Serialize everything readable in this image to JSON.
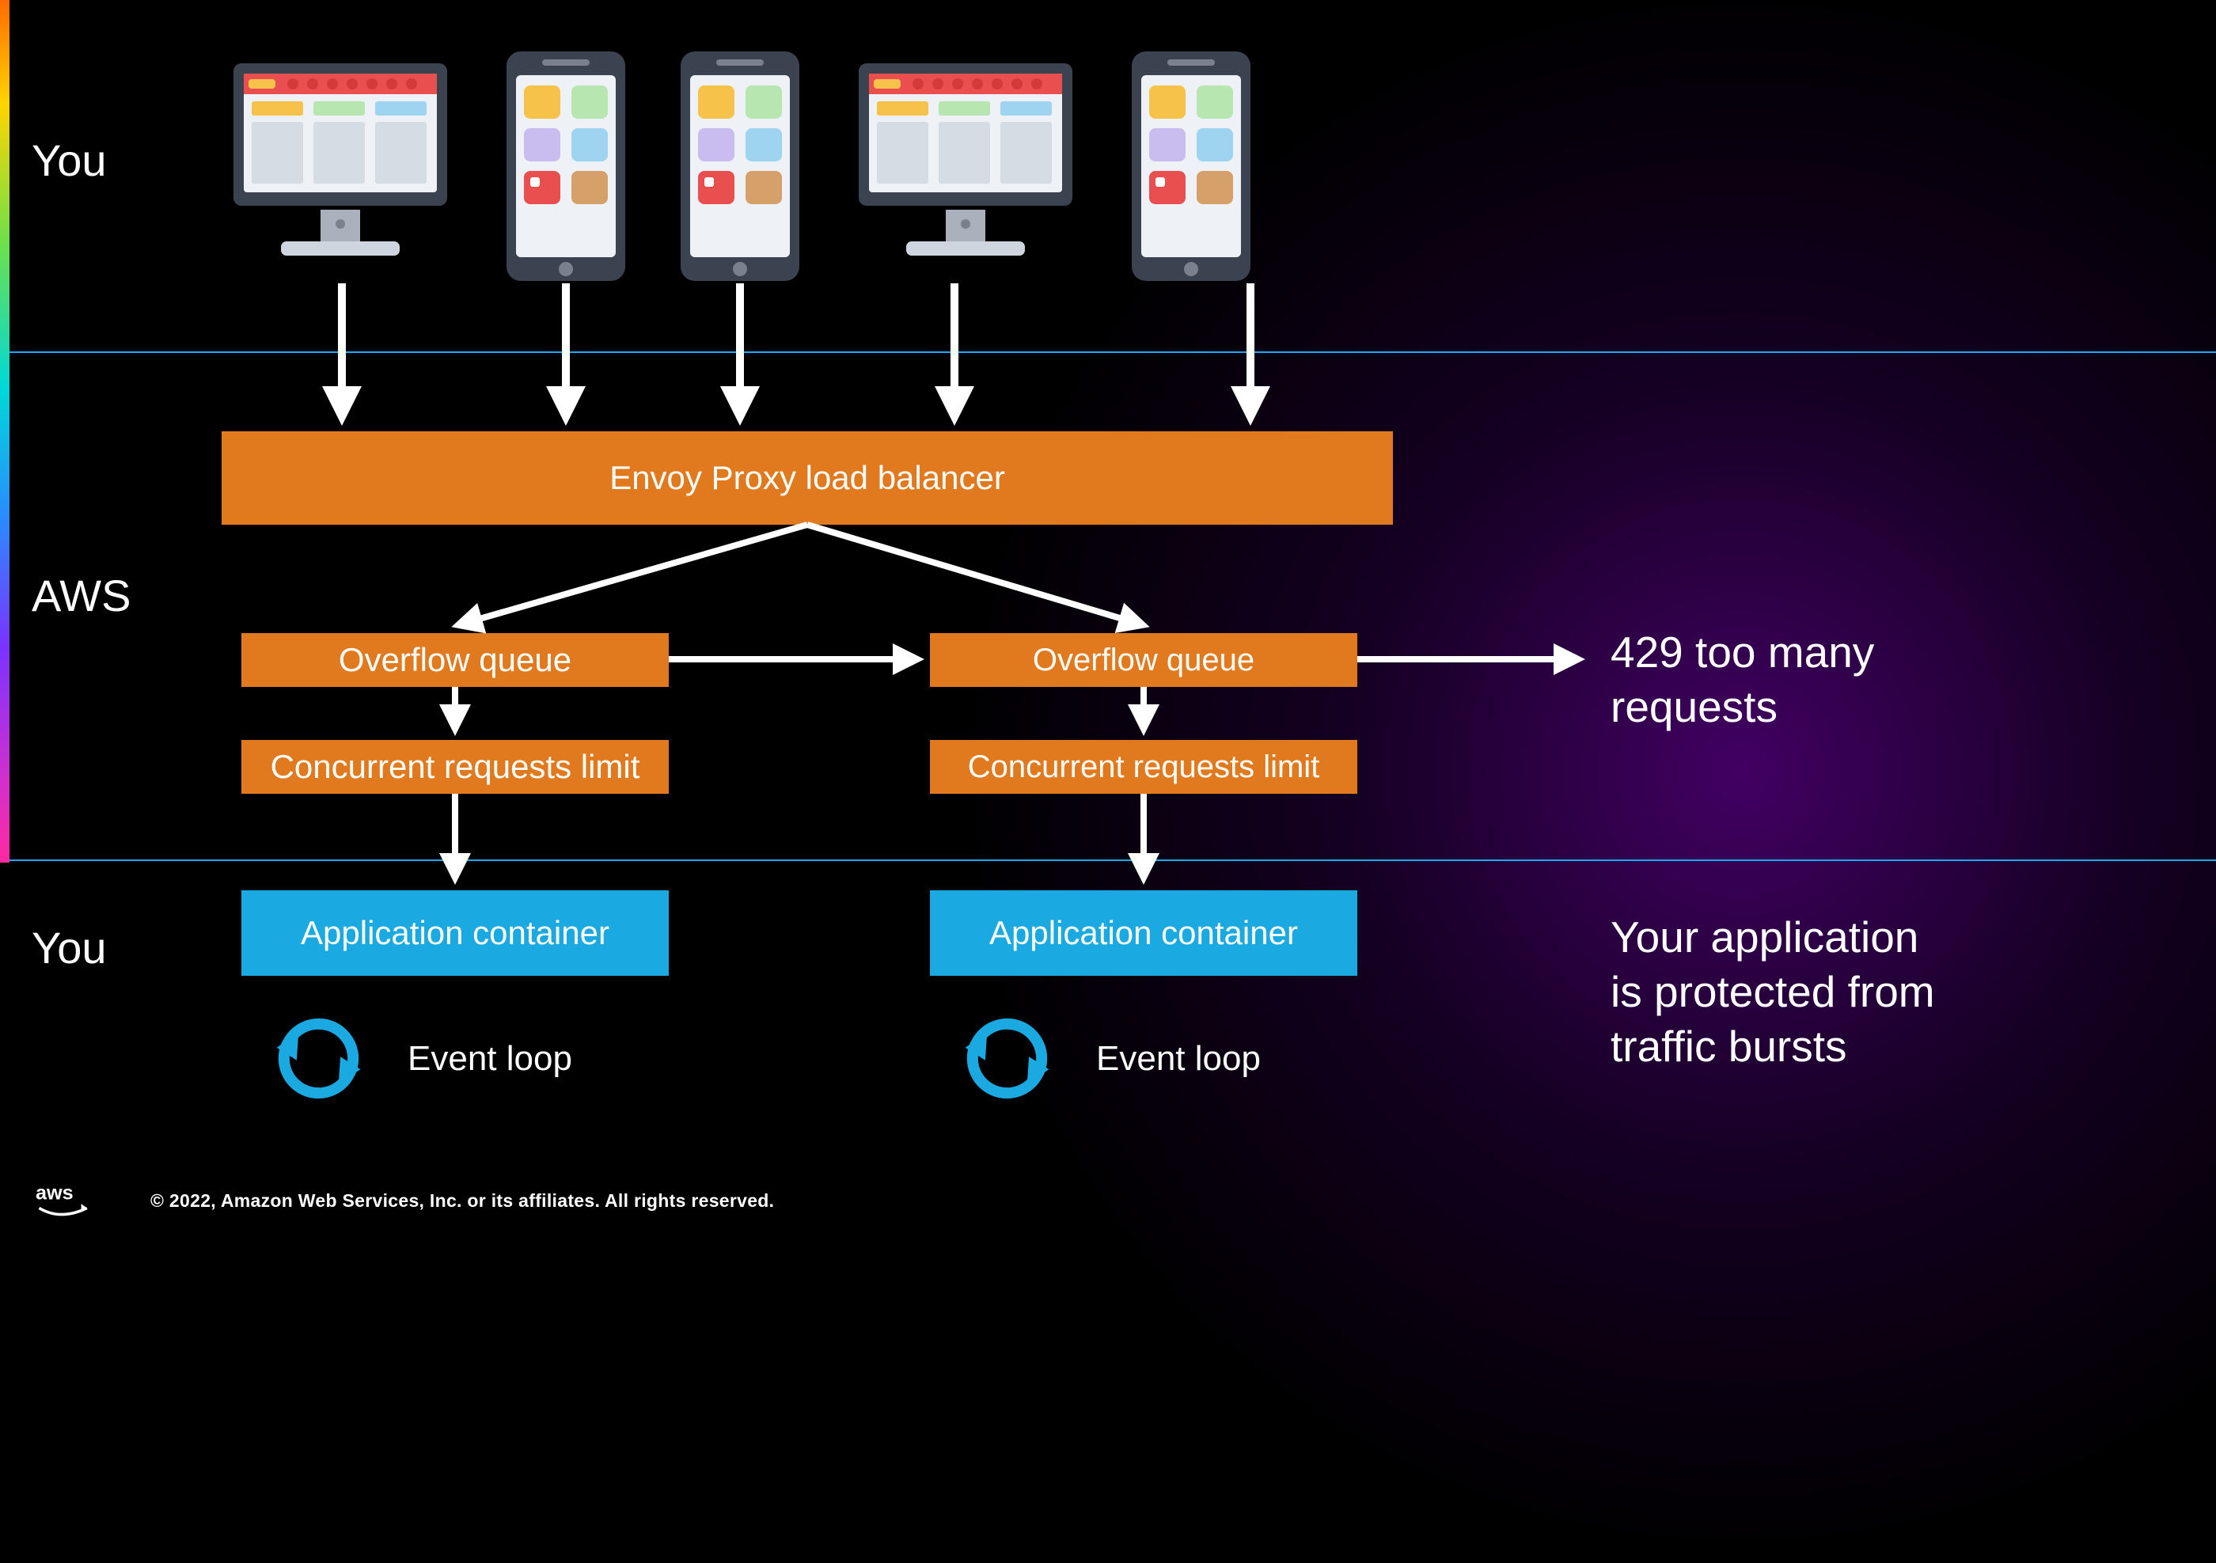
{
  "sections": {
    "top_label": "You",
    "middle_label": "AWS",
    "bottom_label": "You"
  },
  "boxes": {
    "load_balancer": "Envoy Proxy load balancer",
    "overflow_queue": "Overflow queue",
    "concurrent_limit": "Concurrent requests limit",
    "app_container": "Application container"
  },
  "side": {
    "too_many_requests": "429 too many\nrequests",
    "protection": "Your application\nis protected from\ntraffic bursts"
  },
  "event_loop_label": "Event loop",
  "footer": {
    "copyright": "© 2022, Amazon Web Services, Inc. or its affiliates. All rights reserved."
  },
  "colors": {
    "orange": "#e17a1f",
    "blue": "#1aa9e0",
    "accent_line": "#1aa9ff",
    "loop_icon": "#1aa9e0"
  }
}
